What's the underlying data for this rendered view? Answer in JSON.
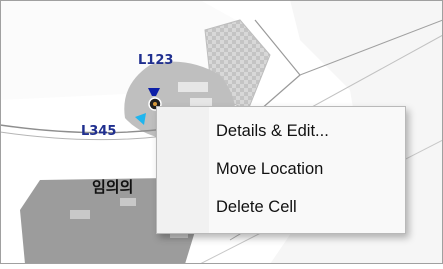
{
  "map": {
    "markers": [
      {
        "label": "L123"
      },
      {
        "label": "L345"
      }
    ],
    "place_label": "임의의",
    "colors": {
      "background": "#ffffff",
      "grass": "#e9e9e9",
      "building": "#a8a8a8",
      "building_dark": "#8e8e8e",
      "marker_blue": "#0d20a8",
      "marker_cyan": "#1fb5ee"
    }
  },
  "context_menu": {
    "items": [
      {
        "label": "Details & Edit..."
      },
      {
        "label": "Move Location"
      },
      {
        "label": "Delete Cell"
      }
    ]
  }
}
